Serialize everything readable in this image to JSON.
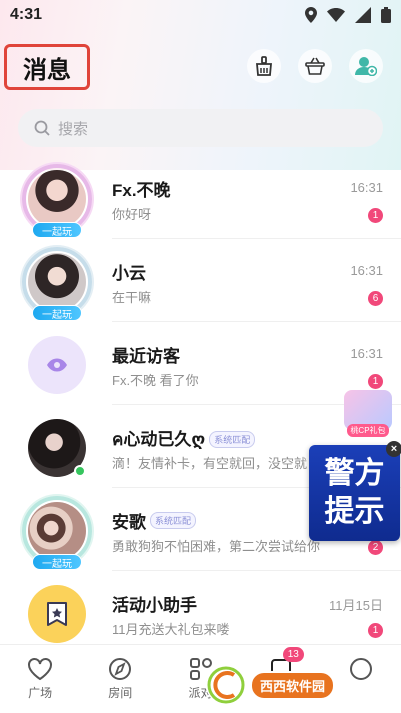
{
  "status_bar": {
    "time": "4:31"
  },
  "header": {
    "title": "消息"
  },
  "search": {
    "placeholder": "搜索"
  },
  "conversations": [
    {
      "name": "Fx.不晚",
      "message": "你好呀",
      "time": "16:31",
      "unread": "1",
      "tag": "一起玩"
    },
    {
      "name": "小云",
      "message": "在干嘛",
      "time": "16:31",
      "unread": "6",
      "tag": "一起玩"
    },
    {
      "name": "最近访客",
      "message": "Fx.不晚 看了你",
      "time": "16:31",
      "unread": "1"
    },
    {
      "name": "ค心动已久ღ",
      "badge": "系统匹配",
      "message": "滴！友情补卡，有空就回，没空就",
      "time": ""
    },
    {
      "name": "安歌",
      "badge": "系统匹配",
      "message": "勇敢狗狗不怕困难，第二次尝试给你",
      "time": "",
      "unread": "2",
      "tag": "一起玩"
    },
    {
      "name": "活动小助手",
      "message": "11月充送大礼包来喽",
      "time": "11月15日",
      "unread": "1"
    }
  ],
  "gift_float": {
    "label": "桃CP礼包"
  },
  "alert_popup": {
    "line1": "警方",
    "line2": "提示"
  },
  "tabbar": {
    "items": [
      {
        "label": "广场"
      },
      {
        "label": "房间"
      },
      {
        "label": "派对"
      },
      {
        "label": "消息",
        "badge": "13"
      },
      {
        "label": ""
      }
    ]
  },
  "watermark": {
    "text": "西西软件园"
  },
  "colors": {
    "accent_pink": "#f1487a",
    "title_border": "#e0443a",
    "play_tag": "#1ea9f0"
  }
}
